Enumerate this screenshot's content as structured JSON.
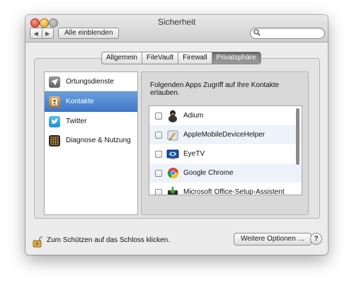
{
  "window": {
    "title": "Sicherheit"
  },
  "toolbar": {
    "back_glyph": "◀",
    "forward_glyph": "▶",
    "show_all_label": "Alle einblenden",
    "search": {
      "value": "",
      "placeholder": ""
    }
  },
  "tabs": [
    {
      "label": "Allgemein",
      "active": false
    },
    {
      "label": "FileVault",
      "active": false
    },
    {
      "label": "Firewall",
      "active": false
    },
    {
      "label": "Privatsphäre",
      "active": true
    }
  ],
  "sidebar": {
    "selected_color": "#3e78c8",
    "items": [
      {
        "label": "Ortungsdienste",
        "icon": "location-arrow-icon",
        "selected": false
      },
      {
        "label": "Kontakte",
        "icon": "contacts-book-icon",
        "selected": true
      },
      {
        "label": "Twitter",
        "icon": "twitter-bird-icon",
        "selected": false
      },
      {
        "label": "Diagnose & Nutzung",
        "icon": "diagnostics-icon",
        "selected": false
      }
    ]
  },
  "main": {
    "heading": "Folgenden Apps Zugriff auf Ihre Kontakte erlauben.",
    "apps": [
      {
        "name": "Adium",
        "icon": "adium-duck-icon",
        "checked": false
      },
      {
        "name": "AppleMobileDeviceHelper",
        "icon": "mobile-device-helper-icon",
        "checked": false
      },
      {
        "name": "EyeTV",
        "icon": "eyetv-icon",
        "checked": false
      },
      {
        "name": "Google Chrome",
        "icon": "chrome-icon",
        "checked": false
      },
      {
        "name": "Microsoft Office-Setup-Assistent",
        "icon": "office-setup-icon",
        "checked": false
      }
    ]
  },
  "footer": {
    "lock_text": "Zum Schützen auf das Schloss klicken.",
    "more_options_label": "Weitere Optionen …",
    "help_label": "?"
  }
}
